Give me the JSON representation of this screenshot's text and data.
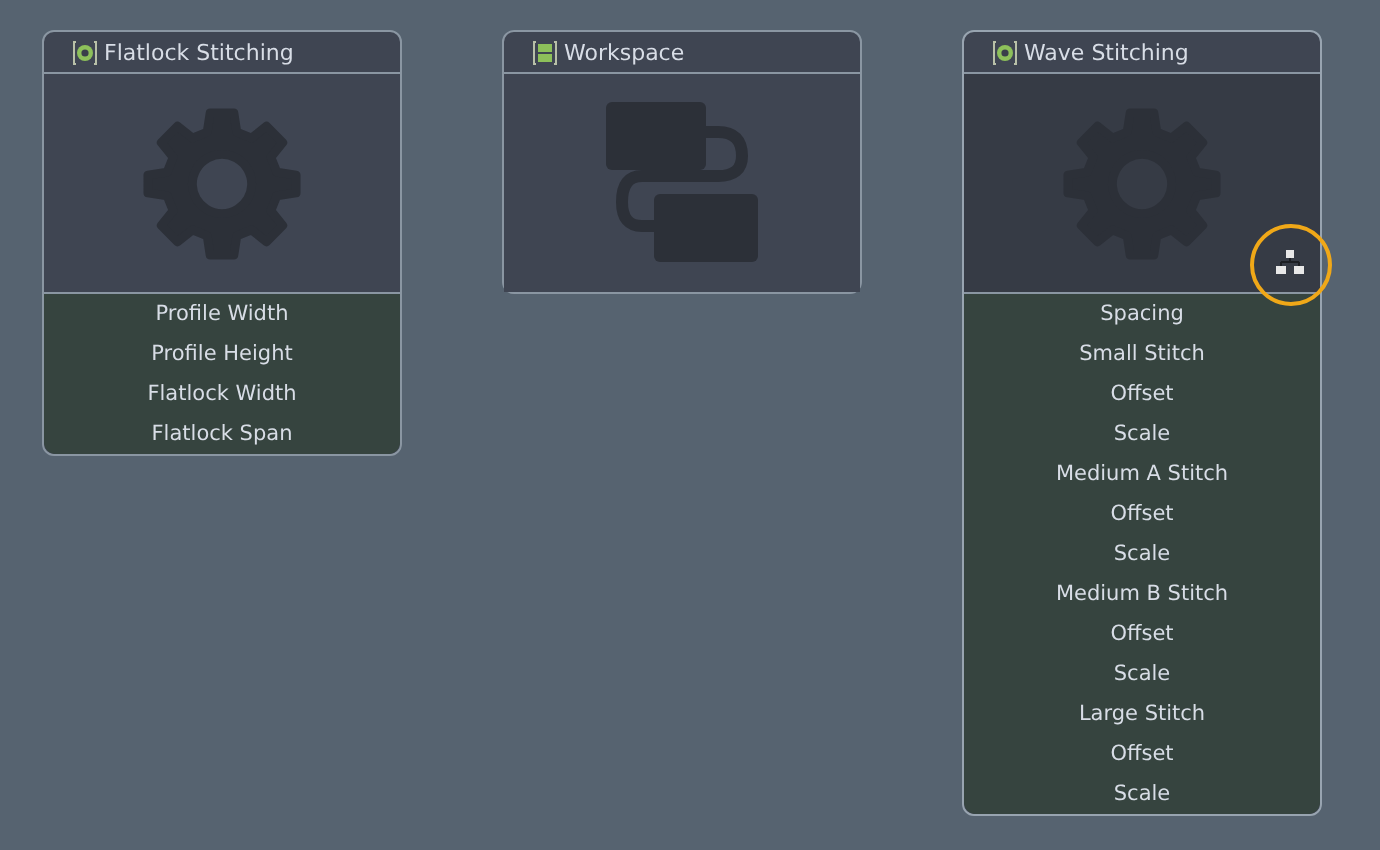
{
  "nodes": [
    {
      "title": "Flatlock Stitching",
      "kind": "gear",
      "selected": false,
      "params": [
        "Profile Width",
        "Profile Height",
        "Flatlock Width",
        "Flatlock Span"
      ]
    },
    {
      "title": "Workspace",
      "kind": "workspace",
      "selected": false
    },
    {
      "title": "Wave Stitching",
      "kind": "gear",
      "selected": true,
      "hierarchy_button": {
        "highlighted": true
      },
      "params": [
        "Spacing",
        "Small Stitch",
        "Offset",
        "Scale",
        "Medium A Stitch",
        "Offset",
        "Scale",
        "Medium B Stitch",
        "Offset",
        "Scale",
        "Large Stitch",
        "Offset",
        "Scale"
      ]
    }
  ]
}
